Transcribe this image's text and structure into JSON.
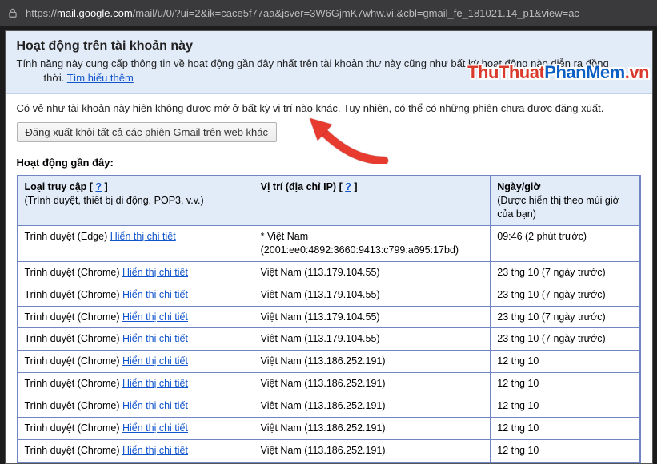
{
  "address_bar": {
    "url_prefix": "https://",
    "domain": "mail.google.com",
    "url_suffix": "/mail/u/0/?ui=2&ik=cace5f77aa&jsver=3W6GjmK7whw.vi.&cbl=gmail_fe_181021.14_p1&view=ac"
  },
  "header": {
    "title": "Hoạt động trên tài khoản này",
    "desc_line1": "Tính năng này cung cấp thông tin về hoạt động gần đây nhất trên tài khoản thư này cũng như bất kỳ hoạt động nào diễn ra đồng",
    "desc_line2_prefix": "thời. ",
    "learn_more": "Tìm hiểu thêm"
  },
  "info_line": "Có vẻ như tài khoản này hiện không được mở ở bất kỳ vị trí nào khác. Tuy nhiên, có thể có những phiên chưa được đăng xuất.",
  "signout_button": "Đăng xuất khỏi tất cả các phiên Gmail trên web khác",
  "recent_title": "Hoạt động gần đây:",
  "watermark": {
    "p1": "ThuThuat",
    "p2": "PhanMem",
    "p3": ".vn"
  },
  "table": {
    "headers": {
      "access_type": "Loại truy cập",
      "access_help": "?",
      "access_sub": "(Trình duyệt, thiết bị di động, POP3, v.v.)",
      "location": "Vị trí (địa chỉ IP)",
      "location_help": "?",
      "datetime": "Ngày/giờ",
      "datetime_sub": "(Được hiển thị theo múi giờ của bạn)"
    },
    "detail_link": "Hiển thị chi tiết",
    "rows": [
      {
        "access": "Trình duyệt (Edge)",
        "loc_line1": "* Việt Nam",
        "loc_line2": "(2001:ee0:4892:3660:9413:c799:a695:17bd)",
        "date": "09:46 (2 phút trước)"
      },
      {
        "access": "Trình duyệt (Chrome)",
        "loc_line1": "Việt Nam (113.179.104.55)",
        "loc_line2": "",
        "date": "23 thg 10 (7 ngày trước)"
      },
      {
        "access": "Trình duyệt (Chrome)",
        "loc_line1": "Việt Nam (113.179.104.55)",
        "loc_line2": "",
        "date": "23 thg 10 (7 ngày trước)"
      },
      {
        "access": "Trình duyệt (Chrome)",
        "loc_line1": "Việt Nam (113.179.104.55)",
        "loc_line2": "",
        "date": "23 thg 10 (7 ngày trước)"
      },
      {
        "access": "Trình duyệt (Chrome)",
        "loc_line1": "Việt Nam (113.179.104.55)",
        "loc_line2": "",
        "date": "23 thg 10 (7 ngày trước)"
      },
      {
        "access": "Trình duyệt (Chrome)",
        "loc_line1": "Việt Nam (113.186.252.191)",
        "loc_line2": "",
        "date": "12 thg 10"
      },
      {
        "access": "Trình duyệt (Chrome)",
        "loc_line1": "Việt Nam (113.186.252.191)",
        "loc_line2": "",
        "date": "12 thg 10"
      },
      {
        "access": "Trình duyệt (Chrome)",
        "loc_line1": "Việt Nam (113.186.252.191)",
        "loc_line2": "",
        "date": "12 thg 10"
      },
      {
        "access": "Trình duyệt (Chrome)",
        "loc_line1": "Việt Nam (113.186.252.191)",
        "loc_line2": "",
        "date": "12 thg 10"
      },
      {
        "access": "Trình duyệt (Chrome)",
        "loc_line1": "Việt Nam (113.186.252.191)",
        "loc_line2": "",
        "date": "12 thg 10"
      }
    ]
  }
}
